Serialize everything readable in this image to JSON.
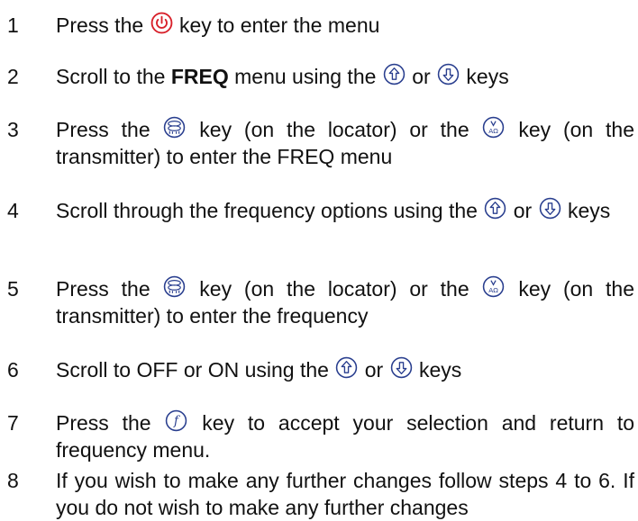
{
  "colors": {
    "power_icon": "#d8202a",
    "key_icon": "#2a3f8f",
    "key_fill": "#ffffff"
  },
  "steps": [
    {
      "num": "1",
      "p1": "Press the",
      "p2": "key to enter the menu"
    },
    {
      "num": "2",
      "p1": "Scroll to the",
      "bold": "FREQ",
      "p2": "menu using the",
      "p3": "or",
      "p4": "keys"
    },
    {
      "num": "3",
      "p1": "Press the",
      "p2": "key (on the locator) or the",
      "p3": "key (on the transmitter) to enter the FREQ menu"
    },
    {
      "num": "4",
      "p1": "Scroll through the frequency options using the",
      "p2": "or",
      "p3": "keys"
    },
    {
      "num": "5",
      "p1": "Press the",
      "p2": "key (on the locator) or the",
      "p3": "key (on the transmitter) to enter the frequency"
    },
    {
      "num": "6",
      "p1": "Scroll to OFF or ON using the",
      "p2": "or",
      "p3": "keys"
    },
    {
      "num": "7",
      "p1": "Press the",
      "p2": "key to accept your selection and return to frequency menu."
    },
    {
      "num": "8",
      "p1": "If you wish to make any further changes follow steps 4 to 6. If you do not wish to make any further changes"
    }
  ],
  "icons": {
    "power": "power-key-icon",
    "up": "up-arrow-key-icon",
    "down": "down-arrow-key-icon",
    "antenna": "antenna-mode-key-icon",
    "va": "volts-ohms-key-icon",
    "function": "function-key-icon"
  }
}
